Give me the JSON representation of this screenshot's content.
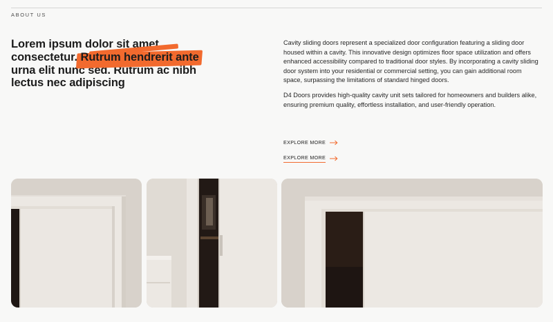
{
  "section": {
    "label": "ABOUT US"
  },
  "headline": {
    "line1": "Lorem ipsum dolor sit amet",
    "line2_plain": "consectetur.",
    "line2_highlight": "Rutrum hendrerit ante",
    "line3": "urna elit nunc sed. Rutrum ac nibh",
    "line4": "lectus nec adipiscing"
  },
  "body": {
    "paragraph1": "Cavity sliding doors represent a specialized door configuration featuring a sliding door housed within a cavity. This innovative design optimizes floor space utilization and offers enhanced accessibility compared to traditional door styles. By incorporating a cavity sliding door system into your residential or commercial setting, you can gain additional room space, surpassing the limitations of standard hinged doors.",
    "paragraph2": "D4 Doors provides high-quality cavity unit sets tailored for homeowners and builders alike, ensuring premium quality, effortless installation, and user-friendly operation."
  },
  "links": [
    {
      "label": "EXPLORE MORE",
      "icon": "arrow-right-icon"
    },
    {
      "label": "EXPLORE MORE",
      "icon": "arrow-right-icon"
    }
  ],
  "colors": {
    "accent": "#f26a2e",
    "background": "#f8f8f7",
    "wall": "#d9d3cc",
    "door": "#ebe7e2",
    "dark_cavity": "#1e1512"
  },
  "gallery": [
    {
      "name": "sliding-door-photo-left"
    },
    {
      "name": "sliding-door-photo-middle"
    },
    {
      "name": "sliding-door-photo-right"
    }
  ]
}
